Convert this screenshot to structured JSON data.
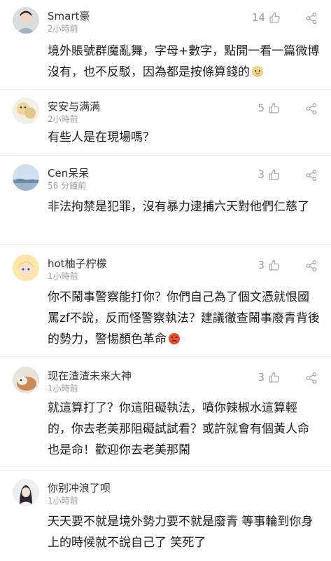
{
  "comments": [
    {
      "user": "Smart豪",
      "time": "2小時前",
      "likes": "14",
      "text": "境外賬號群魔亂舞，字母+數字，點開一看一篇微博沒有，也不反駁，因為都是按條算錢的"
    },
    {
      "user": "安安与满满",
      "time": "2小時前",
      "likes": "5",
      "text": "有些人是在現場嗎？"
    },
    {
      "user": "Cen呆呆",
      "time": "56 分鐘前",
      "likes": "3",
      "text": "非法拘禁是犯罪，沒有暴力逮捕六天對他們仁慈了"
    },
    {
      "user": "hot柚子柠檬",
      "time": "1小時前",
      "likes": "3",
      "text": "你不鬧事警察能打你？你們自己為了個文憑就恨國罵zf不說，反而怪警察執法？建議徹查鬧事廢青背後的勢力，警惕顏色革命"
    },
    {
      "user": "现在渣渣未来大神",
      "time": "1小時前",
      "likes": "3",
      "text": "就這算打了？你這阻礙執法，噴你辣椒水這算輕的，你去老美那阻礙試試看？或許就會有個黃人命也是命！歡迎你去老美那鬧"
    },
    {
      "user": "你别冲浪了呗",
      "time": "1小時前",
      "likes": "",
      "text": "天天要不就是境外勢力要不就是廢青 等事輪到你身上的時候就不說自己了 笑死了"
    }
  ],
  "icons": {
    "like": "thumbs-up-icon",
    "share": "share-icon",
    "emoji": "emoji-icon"
  },
  "colors": {
    "meta": "#9a9a9a",
    "text": "#1c1c1c",
    "divider": "#ededed"
  }
}
